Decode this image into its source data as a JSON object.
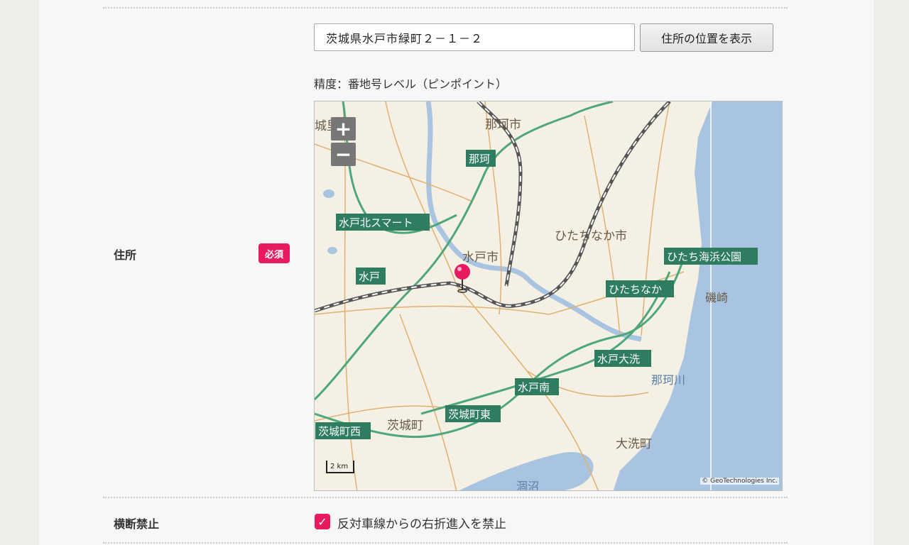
{
  "form": {
    "address": {
      "label": "住所",
      "required_badge": "必須",
      "value": "茨城県水戸市緑町２－１－２",
      "show_button": "住所の位置を表示",
      "precision": "精度：番地号レベル（ピンポイント）"
    },
    "no_crossing": {
      "label": "横断禁止",
      "checkbox_label": "反対車線からの右折進入を禁止",
      "checked": true
    }
  },
  "map": {
    "zoom_in": "+",
    "zoom_out": "−",
    "scale_label": "2 km",
    "copyright": "© GeoTechnologies Inc.",
    "place_labels": [
      "城里町",
      "那珂市",
      "ひたちなか市",
      "水戸市",
      "磯崎",
      "那珂川",
      "茨城町",
      "大洗町",
      "涸沼"
    ],
    "road_labels": [
      "那珂",
      "水戸北スマート",
      "水戸",
      "ひたち海浜公園",
      "ひたちなか",
      "水戸大洗",
      "水戸南",
      "茨城町東",
      "茨城町西"
    ],
    "colors": {
      "sea": "#a9c4e0",
      "land": "#f4f1e4",
      "expressway": "#4da77a",
      "road": "#e0b070",
      "rail": "#555555",
      "label_bg": "#2e7d60",
      "pin": "#e8195f"
    }
  }
}
